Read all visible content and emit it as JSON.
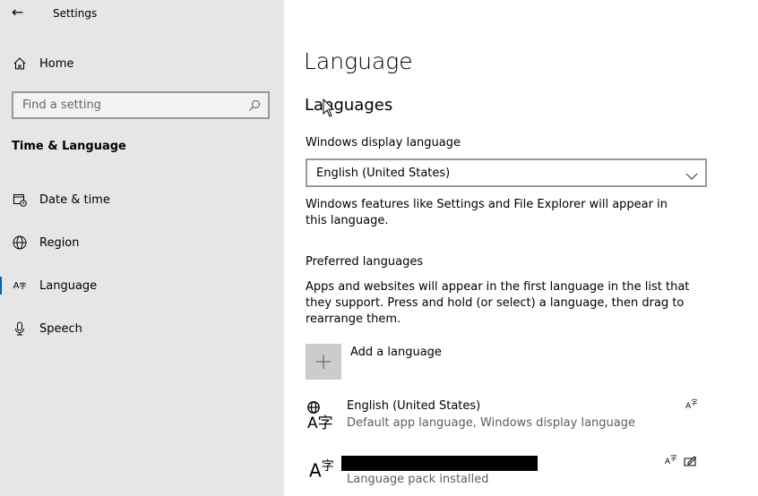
{
  "window": {
    "title": "Settings"
  },
  "sidebar": {
    "home": "Home",
    "search_placeholder": "Find a setting",
    "section": "Time & Language",
    "items": [
      {
        "label": "Date & time",
        "icon": "calendar-clock-icon"
      },
      {
        "label": "Region",
        "icon": "globe-icon"
      },
      {
        "label": "Language",
        "icon": "language-icon",
        "selected": true
      },
      {
        "label": "Speech",
        "icon": "microphone-icon"
      }
    ]
  },
  "main": {
    "title": "Language",
    "subtitle": "Languages",
    "display_label": "Windows display language",
    "display_value": "English (United States)",
    "display_desc": "Windows features like Settings and File Explorer will appear in this language.",
    "preferred_label": "Preferred languages",
    "preferred_desc": "Apps and websites will appear in the first language in the list that they support. Press and hold (or select) a language, then drag to rearrange them.",
    "add_label": "Add a language",
    "languages": [
      {
        "name": "English (United States)",
        "status": "Default app language, Windows display language"
      },
      {
        "name": "",
        "status": "Language pack installed"
      }
    ]
  },
  "colors": {
    "accent": "#0063b1",
    "sidebar_bg": "#e6e6e6"
  }
}
